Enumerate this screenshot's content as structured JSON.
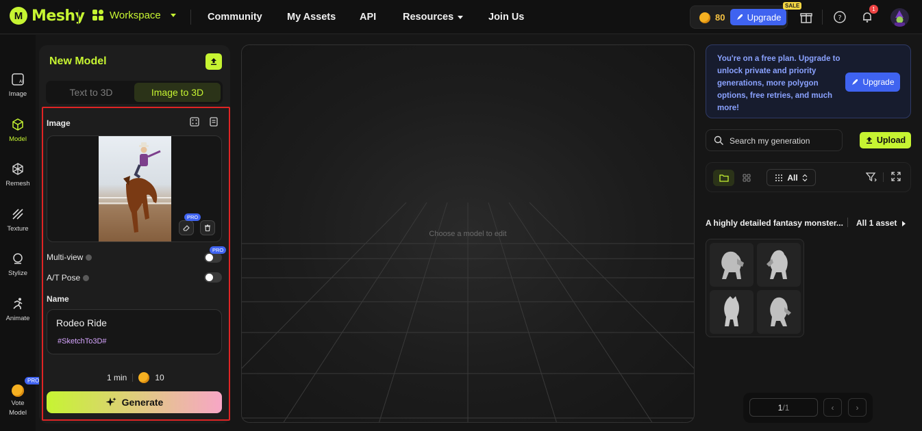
{
  "app": {
    "name": "Meshy"
  },
  "topnav": {
    "workspace": "Workspace",
    "items": [
      "Community",
      "My Assets",
      "API",
      "Resources",
      "Join Us"
    ],
    "credits": "80",
    "upgrade": "Upgrade",
    "sale": "SALE",
    "notifications": "1"
  },
  "sidebar": {
    "items": [
      {
        "label": "Image",
        "icon": "ai-image-icon"
      },
      {
        "label": "Model",
        "icon": "cube-icon"
      },
      {
        "label": "Remesh",
        "icon": "remesh-icon"
      },
      {
        "label": "Texture",
        "icon": "texture-icon"
      },
      {
        "label": "Stylize",
        "icon": "stylize-icon"
      },
      {
        "label": "Animate",
        "icon": "running-icon"
      }
    ],
    "vote": "Vote",
    "vote2": "Model",
    "pro": "PRO"
  },
  "panel": {
    "title": "New Model",
    "tabs": [
      "Text to 3D",
      "Image to 3D"
    ],
    "image_label": "Image",
    "pro": "PRO",
    "multiview": "Multi-view",
    "atpose": "A/T Pose",
    "name_label": "Name",
    "name_value": "Rodeo Ride",
    "name_tag": "#SketchTo3D#",
    "time": "1 min",
    "cost": "10",
    "generate": "Generate"
  },
  "viewport": {
    "hint": "Choose a model to edit"
  },
  "right": {
    "promo": "You're on a free plan. Upgrade to unlock private and priority generations, more polygon options, free retries, and much more!",
    "promo_button": "Upgrade",
    "search_placeholder": "Search my generation",
    "upload": "Upload",
    "filter_all": "All",
    "group_title": "A highly detailed fantasy monster...",
    "group_count": "All 1 asset",
    "page_current": "1",
    "page_total": "/1"
  },
  "colors": {
    "accent": "#c6f432",
    "blue": "#3f63f0",
    "highlight": "#e02424"
  }
}
